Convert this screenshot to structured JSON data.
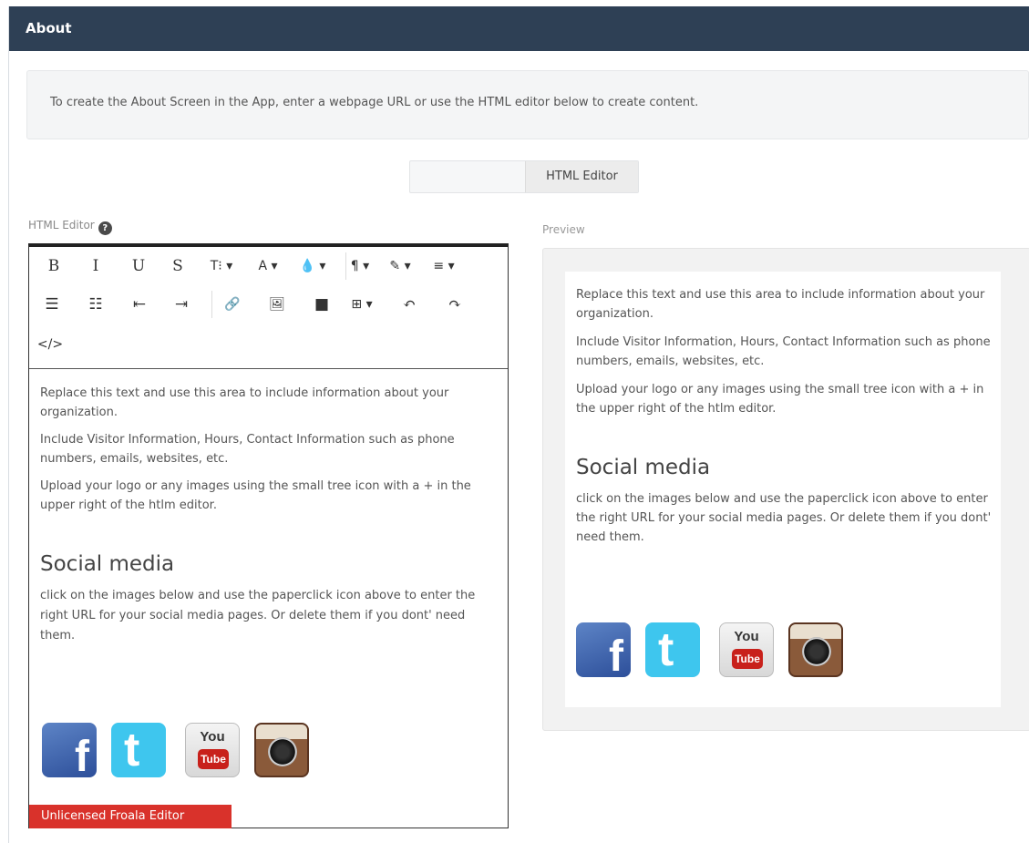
{
  "header": {
    "title": "About"
  },
  "info": {
    "text": "To create the About Screen in the App, enter a webpage URL or use the HTML editor below to create content."
  },
  "toggle": {
    "left_label": "",
    "right_label": "HTML Editor"
  },
  "editor": {
    "label": "HTML Editor",
    "help_glyph": "?",
    "toolbar": {
      "row1": [
        "B",
        "I",
        "U",
        "S",
        "T⁝ ▾",
        "A ▾",
        "💧 ▾",
        "¶ ▾",
        "✎ ▾",
        "≡ ▾"
      ],
      "row1_icons": [
        "bold-icon",
        "italic-icon",
        "underline-icon",
        "strikethrough-icon",
        "font-size-icon",
        "font-color-icon",
        "fill-color-icon",
        "paragraph-format-icon",
        "clear-format-icon",
        "align-icon"
      ],
      "row2": [
        "☰",
        "☷",
        "⇤",
        "⇥",
        "🔗",
        "🖼",
        "■",
        "⊞ ▾",
        "↶",
        "↷"
      ],
      "row2_icons": [
        "ordered-list-icon",
        "unordered-list-icon",
        "outdent-icon",
        "indent-icon",
        "link-icon",
        "image-icon",
        "video-icon",
        "table-icon",
        "undo-icon",
        "redo-icon"
      ],
      "row3": [
        "</>"
      ],
      "row3_icons": [
        "html-code-icon"
      ]
    },
    "content": {
      "p1": "Replace this text and use this area to include information about your organization.",
      "p2": "Include Visitor Information, Hours, Contact Information such as phone numbers, emails, websites, etc.",
      "p3": "Upload your logo or any images using the small tree icon with a + in the upper right of the htlm editor.",
      "heading": "Social media",
      "p4": "click on the images below and use the paperclick icon above to enter the right URL for your social media pages.  Or delete them if you dont' need them."
    },
    "social_icons": [
      {
        "name": "facebook-icon",
        "glyph": "f"
      },
      {
        "name": "twitter-icon",
        "glyph": "t"
      },
      {
        "name": "youtube-icon",
        "top": "You",
        "bottom": "Tube"
      },
      {
        "name": "instagram-icon"
      }
    ],
    "unlicensed": "Unlicensed Froala Editor"
  },
  "preview": {
    "label": "Preview",
    "content": {
      "p1": "Replace this text and use this area to include information about your organization.",
      "p2": "Include Visitor Information, Hours, Contact Information such as phone numbers, emails, websites, etc.",
      "p3": "Upload your logo or any images using the small tree icon with a + in the upper right of the htlm editor.",
      "heading": "Social media",
      "p4": "click on the images below and use the paperclick icon above to enter the right URL for your social media pages.  Or delete them if you dont' need them."
    }
  },
  "colors": {
    "header_bg": "#2e4055",
    "unlicensed_bg": "#d9322b",
    "facebook": "#3b5998",
    "twitter": "#3ec6ee",
    "youtube_red": "#c8211b"
  }
}
